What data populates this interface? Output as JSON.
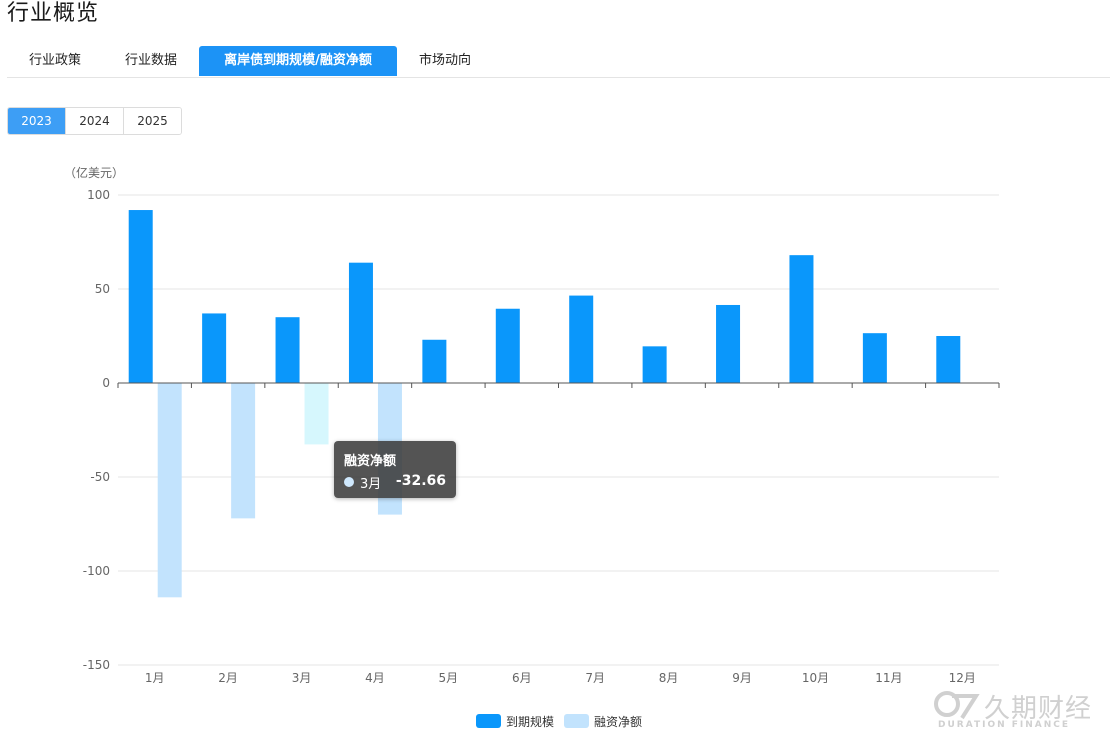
{
  "page": {
    "title": "行业概览"
  },
  "tabs": [
    {
      "label": "行业政策",
      "active": false
    },
    {
      "label": "行业数据",
      "active": false
    },
    {
      "label": "离岸债到期规模/融资净额",
      "active": true
    },
    {
      "label": "市场动向",
      "active": false
    }
  ],
  "years": [
    {
      "label": "2023",
      "active": true
    },
    {
      "label": "2024",
      "active": false
    },
    {
      "label": "2025",
      "active": false
    }
  ],
  "chart_data": {
    "type": "bar",
    "unit_label": "（亿美元）",
    "categories": [
      "1月",
      "2月",
      "3月",
      "4月",
      "5月",
      "6月",
      "7月",
      "8月",
      "9月",
      "10月",
      "11月",
      "12月"
    ],
    "ylim": [
      -150,
      100
    ],
    "yticks": [
      100,
      50,
      0,
      -50,
      -100,
      -150
    ],
    "grid": true,
    "legend_position": "bottom-center",
    "series": [
      {
        "name": "到期规模",
        "color": "#0a97fb",
        "values": [
          92,
          37,
          35,
          64,
          23,
          39.5,
          46.5,
          19.5,
          41.5,
          68,
          26.5,
          25
        ]
      },
      {
        "name": "融资净额",
        "color": "#c2e3fd",
        "values": [
          -114,
          -72,
          -32.66,
          -70,
          null,
          null,
          null,
          null,
          null,
          null,
          null,
          null
        ]
      }
    ]
  },
  "tooltip": {
    "title": "融资净额",
    "category": "3月",
    "value": "-32.66",
    "highlight_color": "#d6f7fd"
  },
  "watermark": {
    "text": "久期财经",
    "sub": "DURATION FINANCE"
  }
}
